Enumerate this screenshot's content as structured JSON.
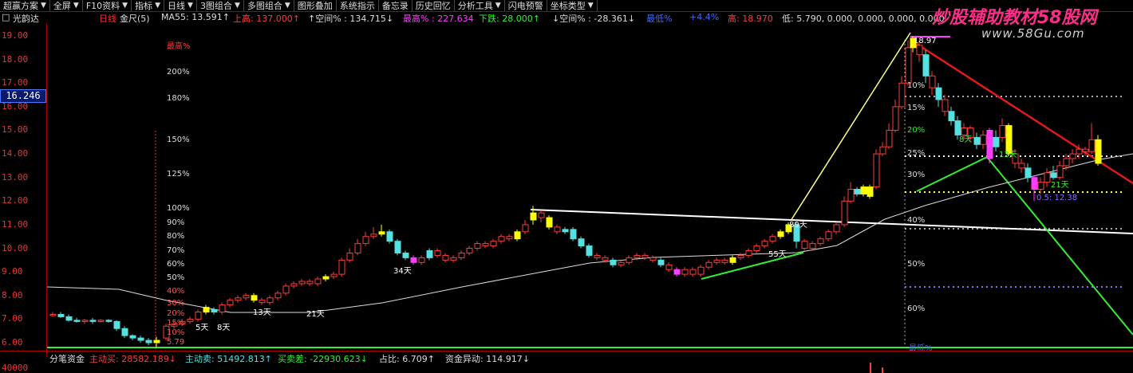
{
  "menubar": {
    "items": [
      {
        "label": "超赢方案",
        "arrow": true
      },
      {
        "label": "全屏",
        "arrow": true
      },
      {
        "label": "F10资料",
        "arrow": true
      },
      {
        "label": "指标",
        "arrow": true
      },
      {
        "label": "日线",
        "arrow": true
      },
      {
        "label": "3图组合",
        "arrow": true
      },
      {
        "label": "多图组合",
        "arrow": true
      },
      {
        "label": "图形叠加",
        "arrow": false
      },
      {
        "label": "系统指示",
        "arrow": false
      },
      {
        "label": "备忘录",
        "arrow": false
      },
      {
        "label": "历史回忆",
        "arrow": false
      },
      {
        "label": "分析工具",
        "arrow": true
      },
      {
        "label": "闪电预警",
        "arrow": false
      },
      {
        "label": "坐标类型",
        "arrow": true
      }
    ]
  },
  "info": {
    "stock_name": "光韵达",
    "period": "日线",
    "indicator": "金尺(5)",
    "ma55_label": "MA55: 13.591↑",
    "high_label": "上高: 137.000↑",
    "space_label": "↑空间% : 134.715↓",
    "maxpct_label": "最高% : 227.634",
    "down_label": "下跌: 28.000↑",
    "space2_label": "↓空间% : -28.361↓",
    "mid_label": "最低%",
    "pct_label": "+4.4%",
    "hi_label": "高: 18.970",
    "lo_label": "低: 5.790, 0.000, 0.000, 0.000, 0.000"
  },
  "watermark": {
    "main": "炒股辅助教材58股网",
    "sub": "www.58Gu.com"
  },
  "axis": {
    "current_price": "16.246",
    "ticks": [
      "19.00",
      "18.00",
      "17.00",
      "16.00",
      "15.00",
      "14.00",
      "13.00",
      "12.00",
      "11.00",
      "10.00",
      "9.00",
      "8.00",
      "7.00",
      "6.00"
    ],
    "lower_tick": "40000"
  },
  "annotations": {
    "max_label": "最高%",
    "pct_left": [
      "200%",
      "180%",
      "150%",
      "125%",
      "100%",
      "90%",
      "80%",
      "70%",
      "60%",
      "50%",
      "40%",
      "30%",
      "20%",
      "15%",
      "10%",
      "5.79"
    ],
    "pct_right": [
      "10%",
      "15%",
      "20%",
      "25%",
      "30%",
      "40%",
      "50%",
      "60%"
    ],
    "days": [
      "5天",
      "8天",
      "13天",
      "21天",
      "34天",
      "55天",
      "89天",
      "8天",
      "13天",
      "21天"
    ],
    "peak_label": "18.97",
    "ratio_label": "0.5: 12.38",
    "bottom_right": "最低%"
  },
  "fundbar": {
    "title": "分笔资金",
    "active_buy": "主动买: 28582.189↓",
    "active_sell": "主动卖: 51492.813↑",
    "diff": "买卖差: -22930.623↓",
    "ratio": "占比: 6.709↑",
    "abnormal": "资金异动: 114.917↓"
  },
  "colors": {
    "up": "#ff3b3b",
    "down": "#54e1e1",
    "gold": "#ffff00",
    "magenta": "#ff3cff",
    "ma": "#dcdcdc",
    "green": "#33ee33",
    "red": "#e01a1a",
    "white": "#ffffff"
  }
}
